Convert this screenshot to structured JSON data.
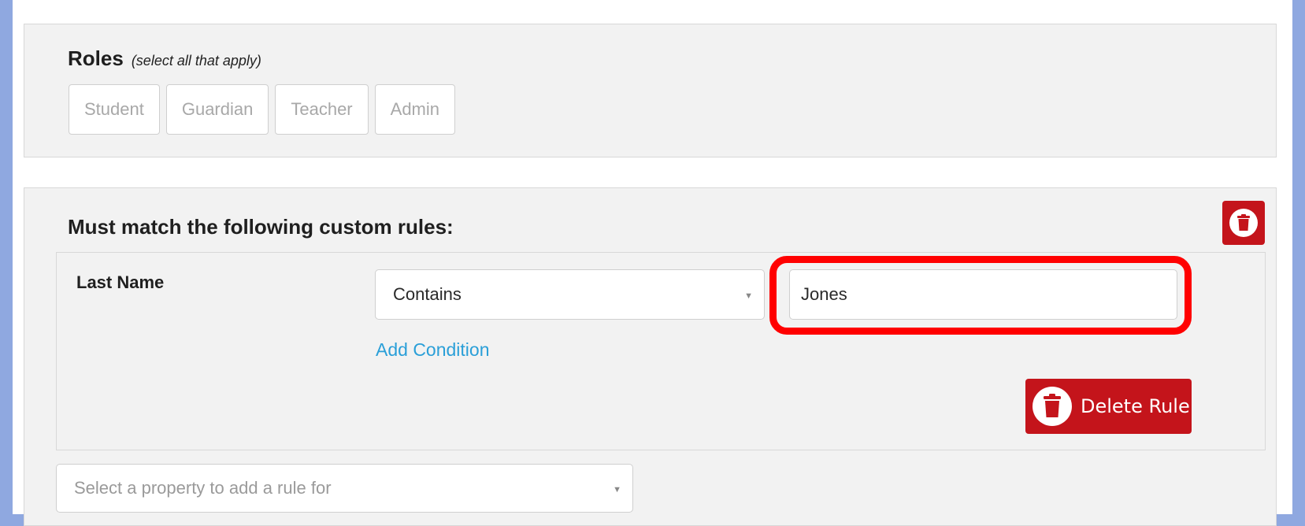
{
  "roles": {
    "title": "Roles",
    "hint": "(select all that apply)",
    "options": [
      "Student",
      "Guardian",
      "Teacher",
      "Admin"
    ]
  },
  "custom_rules": {
    "title": "Must match the following custom rules:",
    "rule": {
      "property_label": "Last Name",
      "condition_selected": "Contains",
      "value": "Jones",
      "add_condition_label": "Add Condition",
      "delete_rule_label": "Delete Rule"
    },
    "property_select_placeholder": "Select a property to add a rule for"
  },
  "icons": {
    "delete_section": "trash-icon",
    "delete_rule": "trash-icon",
    "dropdown": "caret-down-icon"
  },
  "colors": {
    "danger": "#c4141b",
    "link": "#2a9fd8",
    "highlight": "#ff0000",
    "backdrop": "#8fa8e0"
  }
}
